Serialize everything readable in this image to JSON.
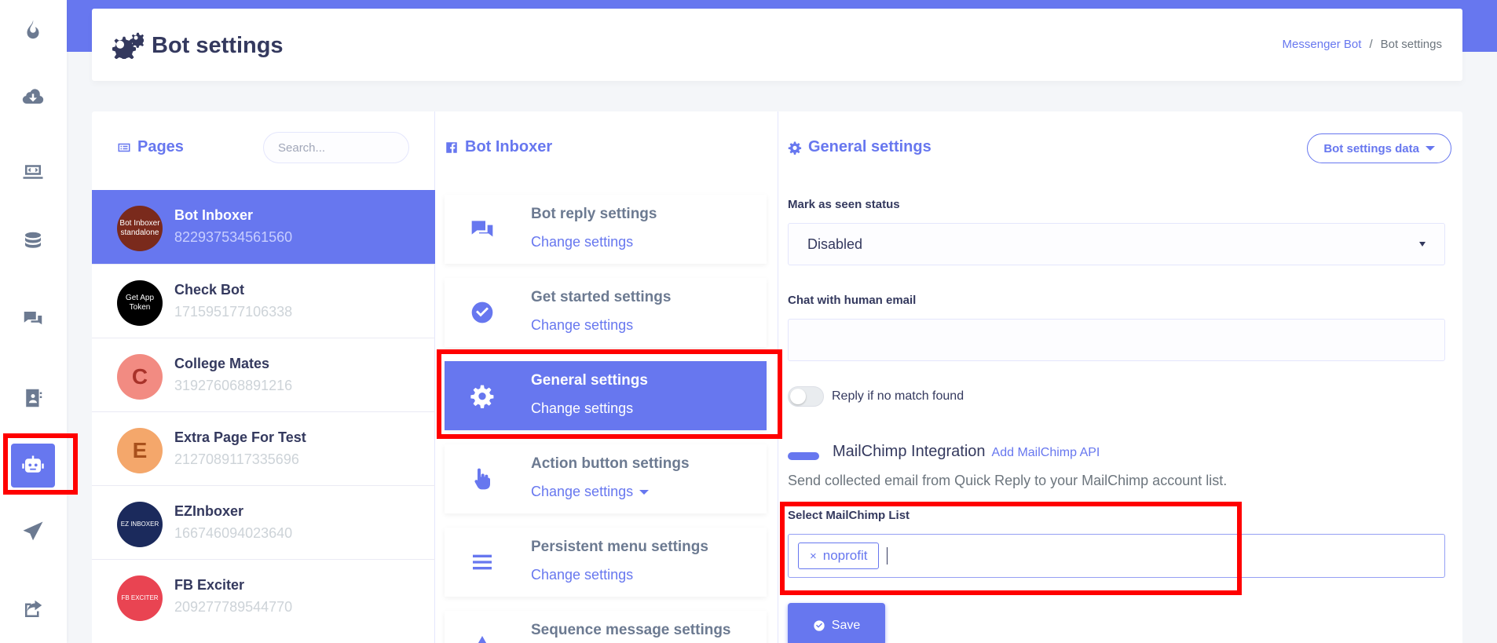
{
  "header": {
    "title": "Bot settings",
    "breadcrumb": {
      "link": "Messenger Bot",
      "separator": "/",
      "current": "Bot settings"
    }
  },
  "sidebar": {
    "icons": [
      "fire-icon",
      "cloud-download-icon",
      "laptop-code-icon",
      "coins-icon",
      "comments-icon",
      "address-book-icon",
      "robot-icon",
      "paper-plane-icon",
      "share-square-icon"
    ],
    "active_index": 6
  },
  "pages_panel": {
    "title": "Pages",
    "search_placeholder": "Search...",
    "items": [
      {
        "name": "Bot Inboxer",
        "id": "822937534561560",
        "avatar_text": "Bot Inboxer standalone",
        "color": "#7a2a1c"
      },
      {
        "name": "Check Bot",
        "id": "171595177106338",
        "avatar_text": "Get App Token",
        "color": "#000000"
      },
      {
        "name": "College Mates",
        "id": "319276068891216",
        "avatar_text": "C",
        "color": "#f28b82"
      },
      {
        "name": "Extra Page For Test",
        "id": "2127089117335696",
        "avatar_text": "E",
        "color": "#f4a76b"
      },
      {
        "name": "EZInboxer",
        "id": "166746094023640",
        "avatar_text": "EZ INBOXER",
        "color": "#1b2a5c"
      },
      {
        "name": "FB Exciter",
        "id": "209277789544770",
        "avatar_text": "FB EXCITER",
        "color": "#e94452"
      }
    ]
  },
  "bot_panel": {
    "title": "Bot Inboxer",
    "link_label": "Change settings",
    "items": [
      {
        "title": "Bot reply settings",
        "icon": "comments-icon"
      },
      {
        "title": "Get started settings",
        "icon": "check-circle-icon"
      },
      {
        "title": "General settings",
        "icon": "gear-icon"
      },
      {
        "title": "Action button settings",
        "icon": "hand-pointer-icon"
      },
      {
        "title": "Persistent menu settings",
        "icon": "bars-icon"
      },
      {
        "title": "Sequence message settings",
        "icon": "sequence-icon"
      }
    ]
  },
  "general_settings": {
    "title": "General settings",
    "dropdown_label": "Bot settings data",
    "mark_seen_label": "Mark as seen status",
    "mark_seen_value": "Disabled",
    "chat_email_label": "Chat with human email",
    "chat_email_value": "",
    "reply_toggle_label": "Reply if no match found",
    "mailchimp_title": "MailChimp Integration",
    "mailchimp_link": "Add MailChimp API",
    "mailchimp_desc": "Send collected email from Quick Reply to your MailChimp account list.",
    "select_list_label": "Select MailChimp List",
    "selected_tag": "noprofit",
    "tag_remove": "×",
    "save_label": "Save"
  },
  "colors": {
    "primary": "#6777ef",
    "highlight": "#ff0000",
    "text": "#34395e"
  }
}
